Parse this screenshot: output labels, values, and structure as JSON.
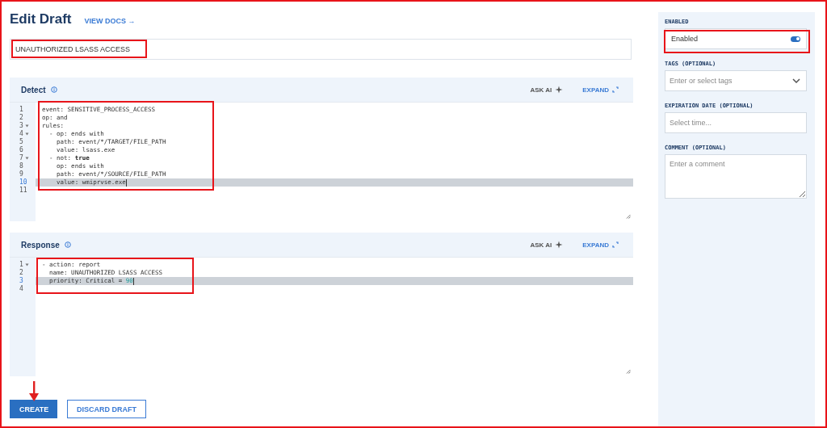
{
  "header": {
    "title": "Edit Draft",
    "docs_link": "VIEW DOCS →"
  },
  "rule_name": {
    "value": "UNAUTHORIZED LSASS ACCESS"
  },
  "panels": [
    {
      "title": "Detect",
      "ask_ai": "ASK AI",
      "expand": "EXPAND",
      "lines": [
        {
          "number": "1",
          "text": "event: SENSITIVE_PROCESS_ACCESS",
          "fold": false,
          "active": false
        },
        {
          "number": "2",
          "text": "op: and",
          "fold": false,
          "active": false
        },
        {
          "number": "3",
          "text": "rules:",
          "fold": true,
          "active": false
        },
        {
          "number": "4",
          "text": "  - op: ends with",
          "fold": true,
          "active": false
        },
        {
          "number": "5",
          "text": "    path: event/*/TARGET/FILE_PATH",
          "fold": false,
          "active": false
        },
        {
          "number": "6",
          "text": "    value: lsass.exe",
          "fold": false,
          "active": false
        },
        {
          "number": "7",
          "text": "  - not: **true**",
          "fold": true,
          "active": false
        },
        {
          "number": "8",
          "text": "    op: ends with",
          "fold": false,
          "active": false
        },
        {
          "number": "9",
          "text": "    path: event/*/SOURCE/FILE_PATH",
          "fold": false,
          "active": false
        },
        {
          "number": "10",
          "text": "    value: wmiprvse.exe",
          "fold": false,
          "active": true
        },
        {
          "number": "11",
          "fold": false,
          "active": false
        }
      ]
    },
    {
      "title": "Response",
      "ask_ai": "ASK AI",
      "expand": "EXPAND",
      "lines": [
        {
          "number": "1",
          "text": "- action: report",
          "fold": true,
          "active": false
        },
        {
          "number": "2",
          "text": "  name: UNAUTHORIZED LSASS ACCESS",
          "fold": false,
          "active": false
        },
        {
          "number": "3",
          "text": "  priority: Critical = ",
          "literal": "90",
          "fold": false,
          "active": true
        },
        {
          "number": "4",
          "fold": false,
          "active": false
        }
      ]
    }
  ],
  "actions": {
    "create": "CREATE",
    "discard": "DISCARD DRAFT"
  },
  "sidebar": {
    "enabled": {
      "label": "ENABLED",
      "text": "Enabled",
      "on": true
    },
    "tags": {
      "label": "TAGS (OPTIONAL)",
      "placeholder": "Enter or select tags"
    },
    "expiration": {
      "label": "EXPIRATION DATE (OPTIONAL)",
      "placeholder": "Select time..."
    },
    "comment": {
      "label": "COMMENT (OPTIONAL)",
      "placeholder": "Enter a comment"
    }
  }
}
